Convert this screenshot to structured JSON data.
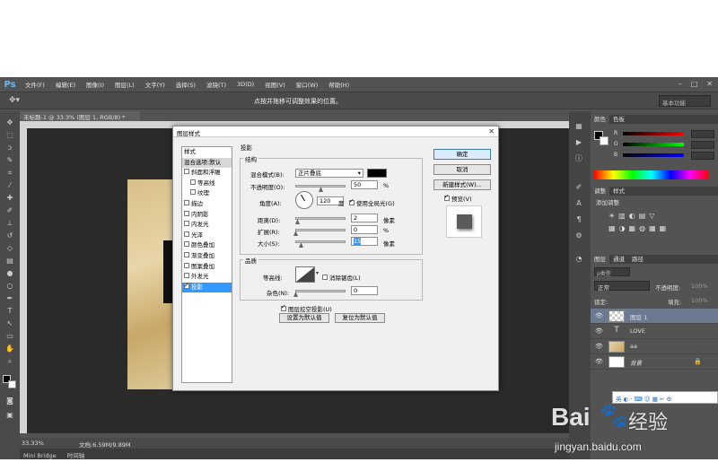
{
  "app": {
    "logo": "Ps"
  },
  "menubar": {
    "items": [
      "文件(F)",
      "编辑(E)",
      "图像(I)",
      "图层(L)",
      "文字(Y)",
      "选择(S)",
      "滤镜(T)",
      "3D(D)",
      "视图(V)",
      "窗口(W)",
      "帮助(H)"
    ]
  },
  "optionsbar": {
    "hint": "点按并拖移可调整效果的位置。",
    "workspace": "基本功能"
  },
  "document": {
    "tab_title": "未标题-1 @ 33.3% (图层 1, RGB/8) *"
  },
  "status": {
    "zoom": "33.33%",
    "doc_size": "文档:6.59M/9.89M"
  },
  "bottom_tab": {
    "label": "Mini Bridge",
    "label2": "时间轴"
  },
  "right_panels": {
    "color_tabs": [
      "颜色",
      "色板"
    ],
    "adjust_tabs": [
      "调整",
      "样式"
    ],
    "adjust_title": "添加调整",
    "layers_tabs": [
      "图层",
      "通道",
      "路径"
    ],
    "kind_label": "ρ类型",
    "blend_mode": "正常",
    "opacity_label": "不透明度:",
    "opacity_value": "100%",
    "lock_label": "锁定:",
    "fill_label": "填充:",
    "fill_value": "100%",
    "layers": [
      {
        "name": "图层 1",
        "type": "pixel"
      },
      {
        "name": "LOVE",
        "type": "text"
      },
      {
        "name": "aa",
        "type": "image"
      },
      {
        "name": "背景",
        "type": "background"
      }
    ],
    "ime_label": "英"
  },
  "dialog": {
    "title": "图层样式",
    "styles_header": "样式",
    "blend_default": "混合选项:默认",
    "styles": [
      {
        "label": "斜面和浮雕",
        "checked": false
      },
      {
        "label": "等高线",
        "checked": false,
        "indent": true
      },
      {
        "label": "纹理",
        "checked": false,
        "indent": true
      },
      {
        "label": "描边",
        "checked": false
      },
      {
        "label": "内阴影",
        "checked": false
      },
      {
        "label": "内发光",
        "checked": false
      },
      {
        "label": "光泽",
        "checked": false
      },
      {
        "label": "颜色叠加",
        "checked": false
      },
      {
        "label": "渐变叠加",
        "checked": false
      },
      {
        "label": "图案叠加",
        "checked": false
      },
      {
        "label": "外发光",
        "checked": false
      },
      {
        "label": "投影",
        "checked": true,
        "selected": true
      }
    ],
    "section_title": "投影",
    "structure": {
      "title": "结构",
      "blend_mode_label": "混合模式(B):",
      "blend_mode_value": "正片叠底",
      "shadow_color": "#000000",
      "opacity_label": "不透明度(O):",
      "opacity_value": "50",
      "opacity_pct": 50,
      "angle_label": "角度(A):",
      "angle_value": "120",
      "angle_unit": "度",
      "global_light_label": "使用全局光(G)",
      "global_light": true,
      "distance_label": "距离(D):",
      "distance_value": "2",
      "spread_label": "扩展(R):",
      "spread_value": "0",
      "size_label": "大小(S):",
      "size_value": "15",
      "unit_px": "像素",
      "unit_pct": "%"
    },
    "quality": {
      "title": "品质",
      "contour_label": "等高线:",
      "antialias_label": "消除锯齿(L)",
      "noise_label": "杂色(N):",
      "noise_value": "0",
      "knockout_label": "图层挖空投影(U)",
      "knockout": true,
      "make_default": "设置为默认值",
      "reset_default": "复位为默认值"
    },
    "buttons": {
      "ok": "确定",
      "cancel": "取消",
      "new_style": "新建样式(W)...",
      "preview": "预览(V)"
    }
  },
  "watermark": {
    "brand": "Bai",
    "brand2": "经验",
    "url": "jingyan.baidu.com"
  }
}
